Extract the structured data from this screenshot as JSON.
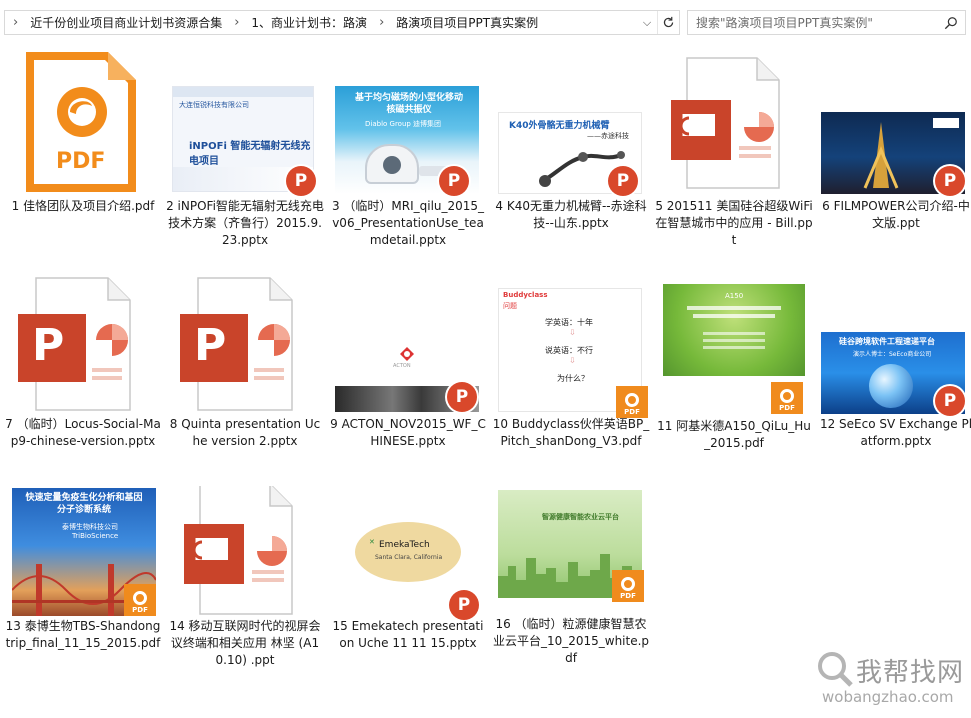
{
  "address_bar": {
    "breadcrumbs": [
      "近千份创业项目商业计划书资源合集",
      "1、商业计划书：路演",
      "路演项目项目PPT真实案例"
    ]
  },
  "search": {
    "placeholder": "搜索\"路演项目项目PPT真实案例\""
  },
  "files": [
    {
      "name": "1 佳恪团队及项目介绍.pdf",
      "type": "pdf-icon"
    },
    {
      "name": "2 iNPOFi智能无辐射无线充电技术方案（齐鲁行）2015.9.23.pptx",
      "type": "ppt-thumb",
      "slide_title": "iNPOFi 智能无辐射无线充电项目",
      "slide_brand": "大连恒锐科技有限公司"
    },
    {
      "name": "3 （临时）MRI_qilu_2015_v06_PresentationUse_teamdetail.pptx",
      "type": "ppt-thumb",
      "slide_title": "基于均匀磁场的小型化移动核磁共振仪",
      "slide_sub": "Diablo Group  迪博集团"
    },
    {
      "name": "4 K40无重力机械臂--赤途科技--山东.pptx",
      "type": "ppt-thumb",
      "slide_title": "K40外骨骼无重力机械臂",
      "slide_sub": "——赤途科技"
    },
    {
      "name": "5 201511 美国硅谷超级WiFi在智慧城市中的应用 - Bill.ppt",
      "type": "ppt-icon"
    },
    {
      "name": "6 FILMPOWER公司介绍-中文版.ppt",
      "type": "ppt-thumb"
    },
    {
      "name": "7 （临时）Locus-Social-Map9-chinese-version.pptx",
      "type": "ppt-big"
    },
    {
      "name": "8 Quinta presentation Uche version 2.pptx",
      "type": "ppt-big"
    },
    {
      "name": "9 ACTON_NOV2015_WF_CHINESE.pptx",
      "type": "ppt-thumb",
      "slide_brand": "ACTON"
    },
    {
      "name": "10 Buddyclass伙伴英语BP_Pitch_shanDong_V3.pdf",
      "type": "pdf-thumb",
      "slide_brand": "Buddyclass",
      "slide_tag": "问题",
      "slide_lines": [
        "学英语：十年",
        "说英语：不行",
        "为什么？"
      ]
    },
    {
      "name": "11 阿基米德A150_QiLu_Hu_2015.pdf",
      "type": "pdf-thumb",
      "slide_title": "A150"
    },
    {
      "name": "12 SeEco SV Exchange Platform.pptx",
      "type": "ppt-thumb",
      "slide_title": "硅谷跨境软件工程速递平台",
      "slide_sub": "演示人博士：SeEco商业公司"
    },
    {
      "name": "13 泰博生物TBS-Shandong trip_final_11_15_2015.pdf",
      "type": "pdf-thumb",
      "slide_title": "快速定量免疫生化分析和基因分子诊断系统",
      "slide_brand": "泰博生物科技公司",
      "slide_sub": "TriBioScience"
    },
    {
      "name": "14 移动互联网时代的视屏会议终端和相关应用  林坚 (A10.10) .ppt",
      "type": "ppt-icon"
    },
    {
      "name": "15 Emekatech presentation Uche 11 11 15.pptx",
      "type": "ppt-thumb",
      "slide_brand": "EmekaTech",
      "slide_sub": "Santa Clara, California"
    },
    {
      "name": "16 （临时）粒源健康智慧农业云平台_10_2015_white.pdf",
      "type": "pdf-thumb",
      "slide_title": "智源健康智能农业云平台"
    }
  ],
  "icon_labels": {
    "pdf": "PDF",
    "ppt": "P"
  },
  "watermark": {
    "title": "我帮找网",
    "url": "wobangzhao.com"
  },
  "colors": {
    "ppt": "#d24726",
    "pdf": "#f08b1d",
    "accent": "#0078d7"
  }
}
